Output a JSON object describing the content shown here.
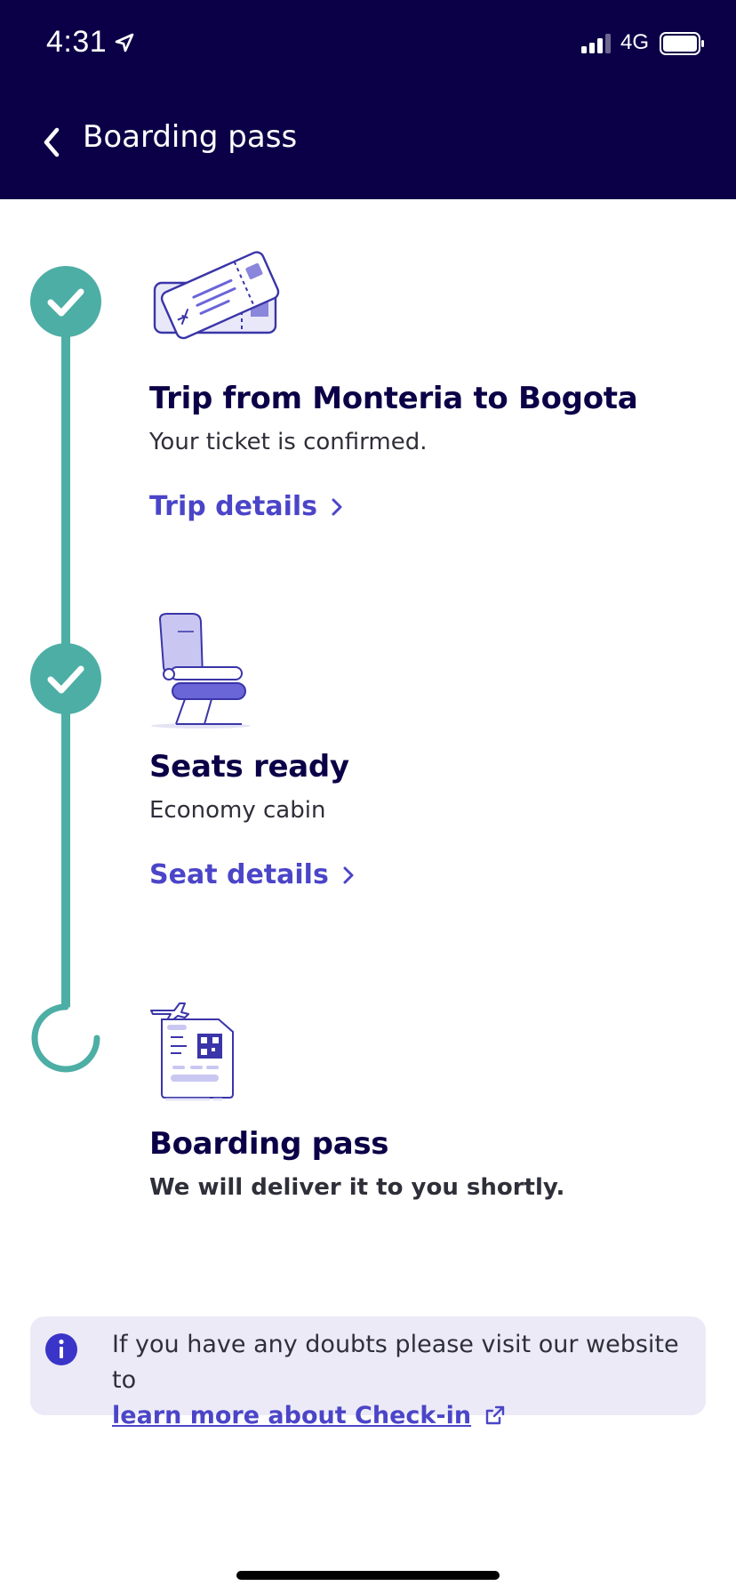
{
  "status_bar": {
    "time": "4:31",
    "network": "4G"
  },
  "header": {
    "title": "Boarding pass"
  },
  "steps": [
    {
      "title": "Trip from Monteria to Bogota",
      "subtitle": "Your ticket is confirmed.",
      "link": "Trip details",
      "state": "done"
    },
    {
      "title": "Seats ready",
      "subtitle": "Economy cabin",
      "link": "Seat details",
      "state": "done"
    },
    {
      "title": "Boarding pass",
      "subtitle": "We will deliver it to you shortly.",
      "state": "pending"
    }
  ],
  "info": {
    "text": "If you have any doubts please visit our website to",
    "link": "learn more about Check-in"
  },
  "colors": {
    "brand": "#0b0047",
    "accent": "#4b45c8",
    "teal": "#4daea5",
    "info_bg": "#eceaf7"
  }
}
